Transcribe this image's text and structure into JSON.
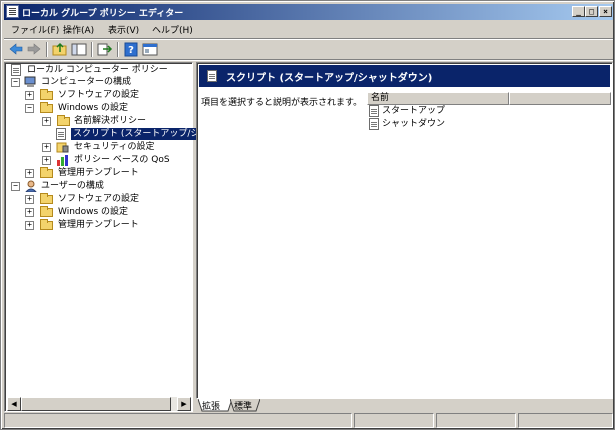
{
  "window": {
    "title": "ローカル グループ ポリシー エディター",
    "buttons": {
      "minimize": "_",
      "maximize": "□",
      "close": "×"
    }
  },
  "menu": {
    "items": [
      "ファイル(F)",
      "操作(A)",
      "表示(V)",
      "ヘルプ(H)"
    ]
  },
  "toolbar": {
    "icons": [
      "back-arrow-icon",
      "forward-arrow-icon",
      "up-folder-icon",
      "show-hide-tree-icon",
      "export-list-icon",
      "help-icon",
      "properties-icon"
    ]
  },
  "tree": {
    "root": "ローカル コンピューター ポリシー",
    "computer_config": "コンピューターの構成",
    "software_settings_1": "ソフトウェアの設定",
    "windows_settings_1": "Windows の設定",
    "name_resolution": "名前解決ポリシー",
    "scripts": "スクリプト (スタートアップ/シャットダ",
    "security_settings": "セキュリティの設定",
    "policy_qos": "ポリシー ベースの QoS",
    "admin_templates_1": "管理用テンプレート",
    "user_config": "ユーザーの構成",
    "software_settings_2": "ソフトウェアの設定",
    "windows_settings_2": "Windows の設定",
    "admin_templates_2": "管理用テンプレート"
  },
  "details": {
    "header": "スクリプト (スタートアップ/シャットダウン)",
    "description": "項目を選択すると説明が表示されます。",
    "column_name": "名前",
    "items": [
      "スタートアップ",
      "シャットダウン"
    ]
  },
  "tabs": {
    "extended": "拡張",
    "standard": "標準"
  },
  "colors": {
    "title_start": "#0a246a",
    "title_end": "#a6caf0",
    "selection": "#0a246a",
    "face": "#d4d0c8"
  }
}
